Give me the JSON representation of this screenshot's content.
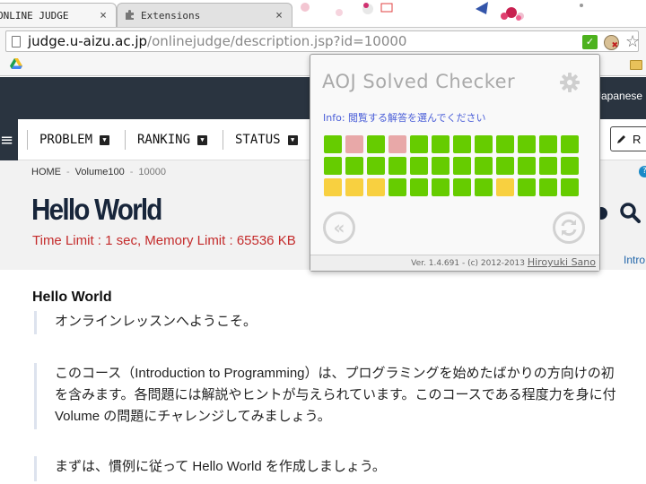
{
  "tabs": [
    {
      "title": "ONLINE JUDGE",
      "close": "×",
      "active": true
    },
    {
      "title": "Extensions",
      "close": "×",
      "active": false
    }
  ],
  "toolbar": {
    "url_host": "judge.u-aizu.ac.jp",
    "url_path": "/onlinejudge/description.jsp?id=10000",
    "extension_check": "✓",
    "star": "☆"
  },
  "site": {
    "language_button": "Japanese",
    "nav": [
      {
        "label": "PROBLEM",
        "caret": "▼"
      },
      {
        "label": "RANKING",
        "caret": "▼"
      },
      {
        "label": "STATUS",
        "caret": "▼"
      }
    ],
    "edit_label": "R",
    "breadcrumb": [
      "HOME",
      "Volume100",
      "10000"
    ],
    "breadcrumb_sep": "-",
    "title": "Hello World",
    "limits": "Time Limit : 1 sec, Memory Limit : 65536 KB",
    "intro_link": "Intro"
  },
  "content": {
    "heading": "Hello World",
    "para1": "オンラインレッスンへようこそ。",
    "para2_line1": "このコース（Introduction to Programming）は、プログラミングを始めたばかりの方向けの初",
    "para2_line2": "を含みます。各問題には解説やヒントが与えられています。このコースである程度力を身に付",
    "para2_line3": "Volume の問題にチャレンジしてみましょう。",
    "para3": "まずは、慣例に従って Hello World を作成しましょう。"
  },
  "popup": {
    "title": "AOJ Solved Checker",
    "info": "Info: 閲覧する解答を選んでください",
    "prev_label": "«",
    "footer_version": "Ver. 1.4.691 - (c) 2012-2013 ",
    "footer_author": "Hiroyuki Sano",
    "colors": {
      "solved": "#66cc00",
      "wrong": "#e8a8a8",
      "pending": "#f8d040"
    },
    "grid": [
      [
        "solved",
        "wrong",
        "solved",
        "wrong",
        "solved",
        "solved",
        "solved",
        "solved",
        "solved",
        "solved",
        "solved",
        "solved"
      ],
      [
        "solved",
        "solved",
        "solved",
        "solved",
        "solved",
        "solved",
        "solved",
        "solved",
        "solved",
        "solved",
        "solved",
        "solved"
      ],
      [
        "pending",
        "pending",
        "pending",
        "solved",
        "solved",
        "solved",
        "solved",
        "solved",
        "pending",
        "solved",
        "solved",
        "solved"
      ]
    ]
  }
}
